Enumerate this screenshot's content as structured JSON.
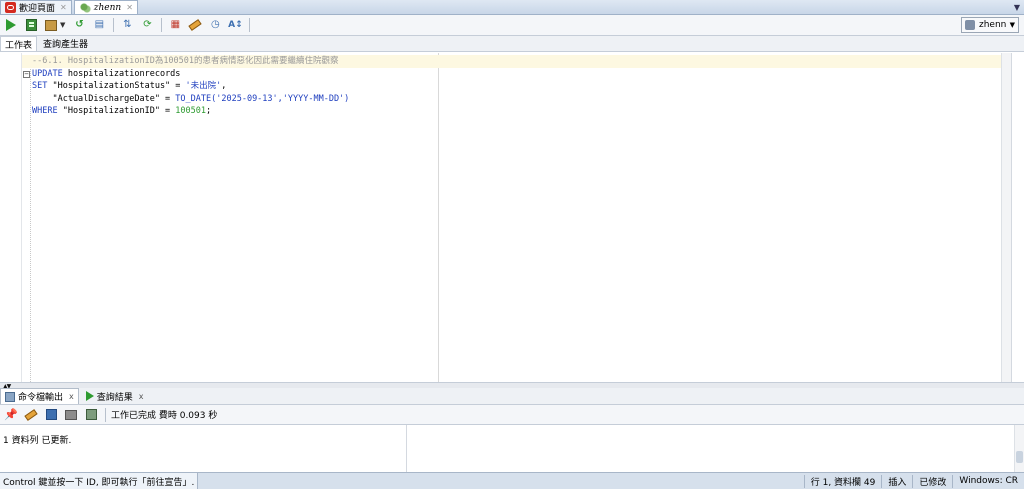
{
  "tabs": [
    {
      "label": "歡迎頁面",
      "icon": "oracle-icon"
    },
    {
      "label": "zhenn",
      "icon": "connection-icon"
    }
  ],
  "toolbar": {
    "connection": "zhenn"
  },
  "subtabs": [
    "工作表",
    "查詢產生器"
  ],
  "code": {
    "line1": "--6.1. HospitalizationID為100501的患者病情惡化因此需要繼續住院觀察",
    "line2_kw": "UPDATE",
    "line2_rest": " hospitalizationrecords",
    "line3_kw": "SET",
    "line3_col": " \"HospitalizationStatus\" = ",
    "line3_val": "'未出院'",
    "line3_end": ",",
    "line4_col": "    \"ActualDischargeDate\" = ",
    "line4_fn": "TO_DATE",
    "line4_args": "('2025-09-13','YYYY-MM-DD')",
    "line5_kw": "WHERE",
    "line5_col": " \"HospitalizationID\" = ",
    "line5_num": "100501",
    "line5_end": ";"
  },
  "output_tabs": [
    {
      "label": "命令檔輸出",
      "close": "x"
    },
    {
      "label": "查詢結果",
      "close": "x"
    }
  ],
  "output_toolbar": {
    "status": "工作已完成 費時 0.093 秒"
  },
  "output": {
    "message": "1 資料列 已更新."
  },
  "statusbar": {
    "hint": "Control 鍵並按一下 ID, 即可執行「前往宣告」.",
    "position": "行 1, 資料欄 49",
    "insert": "插入",
    "modified": "已修改",
    "platform": "Windows: CR"
  }
}
